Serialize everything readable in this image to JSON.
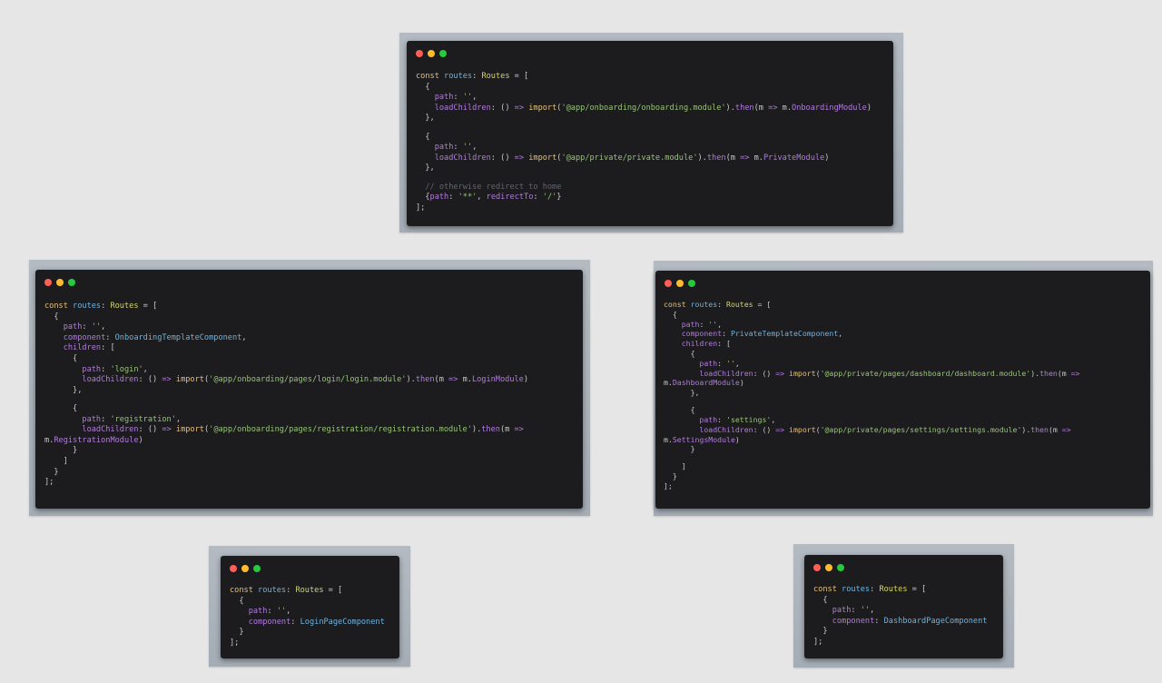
{
  "colors": {
    "background": "#e6e6e6",
    "frame": "#a9b0b8",
    "editor": "#1c1c1e",
    "dot_red": "#ff5f56",
    "dot_yellow": "#ffbd2e",
    "dot_green": "#27c93f",
    "keyword": "#e5c07b",
    "variable": "#6fb3e0",
    "type": "#d6d66a",
    "property": "#b07ddb",
    "string": "#98c379",
    "comment": "#5e6670"
  },
  "icons": [
    "close-dot-icon",
    "minimize-dot-icon",
    "maximize-dot-icon"
  ],
  "snippets": [
    {
      "id": "app-routes",
      "lines": [
        [
          [
            "k",
            "const "
          ],
          [
            "v",
            "routes"
          ],
          [
            "o",
            ": "
          ],
          [
            "t",
            "Routes"
          ],
          [
            "o",
            " = ["
          ]
        ],
        [
          [
            "o",
            "  {"
          ]
        ],
        [
          [
            "p",
            "    path"
          ],
          [
            "o",
            ": "
          ],
          [
            "s",
            "''"
          ],
          [
            "o",
            ","
          ]
        ],
        [
          [
            "p",
            "    loadChildren"
          ],
          [
            "o",
            ": () "
          ],
          [
            "m",
            "=>"
          ],
          [
            "o",
            " "
          ],
          [
            "im",
            "import"
          ],
          [
            "o",
            "("
          ],
          [
            "s",
            "'@app/onboarding/onboarding.module'"
          ],
          [
            "o",
            ")."
          ],
          [
            "m",
            "then"
          ],
          [
            "o",
            "(m "
          ],
          [
            "m",
            "=>"
          ],
          [
            "o",
            " m."
          ],
          [
            "p",
            "OnboardingModule"
          ],
          [
            "o",
            ")"
          ]
        ],
        [
          [
            "o",
            "  },"
          ]
        ],
        [
          [
            "o",
            ""
          ]
        ],
        [
          [
            "o",
            "  {"
          ]
        ],
        [
          [
            "p",
            "    path"
          ],
          [
            "o",
            ": "
          ],
          [
            "s",
            "''"
          ],
          [
            "o",
            ","
          ]
        ],
        [
          [
            "p",
            "    loadChildren"
          ],
          [
            "o",
            ": () "
          ],
          [
            "m",
            "=>"
          ],
          [
            "o",
            " "
          ],
          [
            "im",
            "import"
          ],
          [
            "o",
            "("
          ],
          [
            "s",
            "'@app/private/private.module'"
          ],
          [
            "o",
            ")."
          ],
          [
            "m",
            "then"
          ],
          [
            "o",
            "(m "
          ],
          [
            "m",
            "=>"
          ],
          [
            "o",
            " m."
          ],
          [
            "p",
            "PrivateModule"
          ],
          [
            "o",
            ")"
          ]
        ],
        [
          [
            "o",
            "  },"
          ]
        ],
        [
          [
            "o",
            ""
          ]
        ],
        [
          [
            "c",
            "  // otherwise redirect to home"
          ]
        ],
        [
          [
            "o",
            "  {"
          ],
          [
            "p",
            "path"
          ],
          [
            "o",
            ": "
          ],
          [
            "s",
            "'**'"
          ],
          [
            "o",
            ", "
          ],
          [
            "p",
            "redirectTo"
          ],
          [
            "o",
            ": "
          ],
          [
            "s",
            "'/'"
          ],
          [
            "o",
            "}"
          ]
        ],
        [
          [
            "o",
            "];"
          ]
        ]
      ]
    },
    {
      "id": "onboarding-routes",
      "lines": [
        [
          [
            "k",
            "const "
          ],
          [
            "v",
            "routes"
          ],
          [
            "o",
            ": "
          ],
          [
            "t",
            "Routes"
          ],
          [
            "o",
            " = ["
          ]
        ],
        [
          [
            "o",
            "  {"
          ]
        ],
        [
          [
            "p",
            "    path"
          ],
          [
            "o",
            ": "
          ],
          [
            "s",
            "''"
          ],
          [
            "o",
            ","
          ]
        ],
        [
          [
            "p",
            "    component"
          ],
          [
            "o",
            ": "
          ],
          [
            "v",
            "OnboardingTemplateComponent"
          ],
          [
            "o",
            ","
          ]
        ],
        [
          [
            "p",
            "    children"
          ],
          [
            "o",
            ": ["
          ]
        ],
        [
          [
            "o",
            "      {"
          ]
        ],
        [
          [
            "p",
            "        path"
          ],
          [
            "o",
            ": "
          ],
          [
            "s",
            "'login'"
          ],
          [
            "o",
            ","
          ]
        ],
        [
          [
            "p",
            "        loadChildren"
          ],
          [
            "o",
            ": () "
          ],
          [
            "m",
            "=>"
          ],
          [
            "o",
            " "
          ],
          [
            "im",
            "import"
          ],
          [
            "o",
            "("
          ],
          [
            "s",
            "'@app/onboarding/pages/login/login.module'"
          ],
          [
            "o",
            ")."
          ],
          [
            "m",
            "then"
          ],
          [
            "o",
            "(m "
          ],
          [
            "m",
            "=>"
          ],
          [
            "o",
            " m."
          ],
          [
            "p",
            "LoginModule"
          ],
          [
            "o",
            ")"
          ]
        ],
        [
          [
            "o",
            "      },"
          ]
        ],
        [
          [
            "o",
            ""
          ]
        ],
        [
          [
            "o",
            "      {"
          ]
        ],
        [
          [
            "p",
            "        path"
          ],
          [
            "o",
            ": "
          ],
          [
            "s",
            "'registration'"
          ],
          [
            "o",
            ","
          ]
        ],
        [
          [
            "p",
            "        loadChildren"
          ],
          [
            "o",
            ": () "
          ],
          [
            "m",
            "=>"
          ],
          [
            "o",
            " "
          ],
          [
            "im",
            "import"
          ],
          [
            "o",
            "("
          ],
          [
            "s",
            "'@app/onboarding/pages/registration/registration.module'"
          ],
          [
            "o",
            ")."
          ],
          [
            "m",
            "then"
          ],
          [
            "o",
            "(m "
          ],
          [
            "m",
            "=>"
          ]
        ],
        [
          [
            "o",
            "m."
          ],
          [
            "p",
            "RegistrationModule"
          ],
          [
            "o",
            ")"
          ]
        ],
        [
          [
            "o",
            "      }"
          ]
        ],
        [
          [
            "o",
            "    ]"
          ]
        ],
        [
          [
            "o",
            "  }"
          ]
        ],
        [
          [
            "o",
            "];"
          ]
        ]
      ]
    },
    {
      "id": "private-routes",
      "lines": [
        [
          [
            "k",
            "const "
          ],
          [
            "v",
            "routes"
          ],
          [
            "o",
            ": "
          ],
          [
            "t",
            "Routes"
          ],
          [
            "o",
            " = ["
          ]
        ],
        [
          [
            "o",
            "  {"
          ]
        ],
        [
          [
            "p",
            "    path"
          ],
          [
            "o",
            ": "
          ],
          [
            "s",
            "''"
          ],
          [
            "o",
            ","
          ]
        ],
        [
          [
            "p",
            "    component"
          ],
          [
            "o",
            ": "
          ],
          [
            "v",
            "PrivateTemplateComponent"
          ],
          [
            "o",
            ","
          ]
        ],
        [
          [
            "p",
            "    children"
          ],
          [
            "o",
            ": ["
          ]
        ],
        [
          [
            "o",
            "      {"
          ]
        ],
        [
          [
            "p",
            "        path"
          ],
          [
            "o",
            ": "
          ],
          [
            "s",
            "''"
          ],
          [
            "o",
            ","
          ]
        ],
        [
          [
            "p",
            "        loadChildren"
          ],
          [
            "o",
            ": () "
          ],
          [
            "m",
            "=>"
          ],
          [
            "o",
            " "
          ],
          [
            "im",
            "import"
          ],
          [
            "o",
            "("
          ],
          [
            "s",
            "'@app/private/pages/dashboard/dashboard.module'"
          ],
          [
            "o",
            ")."
          ],
          [
            "m",
            "then"
          ],
          [
            "o",
            "(m "
          ],
          [
            "m",
            "=>"
          ]
        ],
        [
          [
            "o",
            "m."
          ],
          [
            "p",
            "DashboardModule"
          ],
          [
            "o",
            ")"
          ]
        ],
        [
          [
            "o",
            "      },"
          ]
        ],
        [
          [
            "o",
            ""
          ]
        ],
        [
          [
            "o",
            "      {"
          ]
        ],
        [
          [
            "p",
            "        path"
          ],
          [
            "o",
            ": "
          ],
          [
            "s",
            "'settings'"
          ],
          [
            "o",
            ","
          ]
        ],
        [
          [
            "p",
            "        loadChildren"
          ],
          [
            "o",
            ": () "
          ],
          [
            "m",
            "=>"
          ],
          [
            "o",
            " "
          ],
          [
            "im",
            "import"
          ],
          [
            "o",
            "("
          ],
          [
            "s",
            "'@app/private/pages/settings/settings.module'"
          ],
          [
            "o",
            ")."
          ],
          [
            "m",
            "then"
          ],
          [
            "o",
            "(m "
          ],
          [
            "m",
            "=>"
          ]
        ],
        [
          [
            "o",
            "m."
          ],
          [
            "p",
            "SettingsModule"
          ],
          [
            "o",
            ")"
          ]
        ],
        [
          [
            "o",
            "      }"
          ]
        ],
        [
          [
            "o",
            ""
          ]
        ],
        [
          [
            "o",
            "    ]"
          ]
        ],
        [
          [
            "o",
            "  }"
          ]
        ],
        [
          [
            "o",
            "];"
          ]
        ]
      ]
    },
    {
      "id": "login-routes",
      "lines": [
        [
          [
            "k",
            "const "
          ],
          [
            "v",
            "routes"
          ],
          [
            "o",
            ": "
          ],
          [
            "t",
            "Routes"
          ],
          [
            "o",
            " = ["
          ]
        ],
        [
          [
            "o",
            "  {"
          ]
        ],
        [
          [
            "p",
            "    path"
          ],
          [
            "o",
            ": "
          ],
          [
            "s",
            "''"
          ],
          [
            "o",
            ","
          ]
        ],
        [
          [
            "p",
            "    component"
          ],
          [
            "o",
            ": "
          ],
          [
            "v",
            "LoginPageComponent"
          ]
        ],
        [
          [
            "o",
            "  }"
          ]
        ],
        [
          [
            "o",
            "];"
          ]
        ]
      ]
    },
    {
      "id": "dashboard-routes",
      "lines": [
        [
          [
            "k",
            "const "
          ],
          [
            "v",
            "routes"
          ],
          [
            "o",
            ": "
          ],
          [
            "t",
            "Routes"
          ],
          [
            "o",
            " = ["
          ]
        ],
        [
          [
            "o",
            "  {"
          ]
        ],
        [
          [
            "p",
            "    path"
          ],
          [
            "o",
            ": "
          ],
          [
            "s",
            "''"
          ],
          [
            "o",
            ","
          ]
        ],
        [
          [
            "p",
            "    component"
          ],
          [
            "o",
            ": "
          ],
          [
            "v",
            "DashboardPageComponent"
          ]
        ],
        [
          [
            "o",
            "  }"
          ]
        ],
        [
          [
            "o",
            "];"
          ]
        ]
      ]
    }
  ]
}
